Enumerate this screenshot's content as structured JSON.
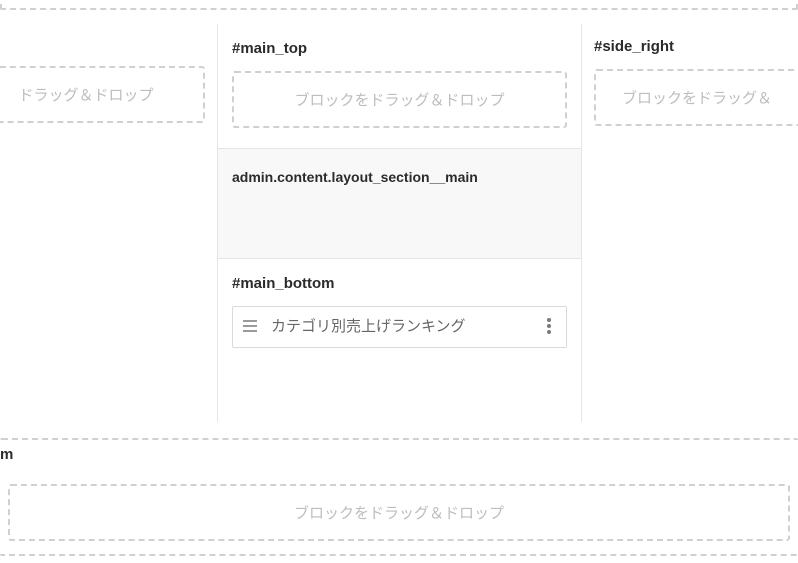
{
  "placeholders": {
    "drag_drop": "ブロックをドラッグ＆ドロップ",
    "drag_drop_leftcrop": "ドラッグ＆ドロップ",
    "drag_drop_rightcrop": "ブロックをドラッグ＆"
  },
  "left": {
    "drop": "placeholders.drag_drop_leftcrop"
  },
  "mid": {
    "top": {
      "heading": "#main_top",
      "drop": "placeholders.drag_drop"
    },
    "main": {
      "heading": "admin.content.layout_section__main"
    },
    "bottom": {
      "heading": "#main_bottom",
      "block": {
        "label": "カテゴリ別売上げランキング"
      }
    }
  },
  "right": {
    "heading": "#side_right",
    "drop": "placeholders.drag_drop_rightcrop"
  },
  "bottom": {
    "heading_fragment": "m",
    "drop": "placeholders.drag_drop"
  }
}
